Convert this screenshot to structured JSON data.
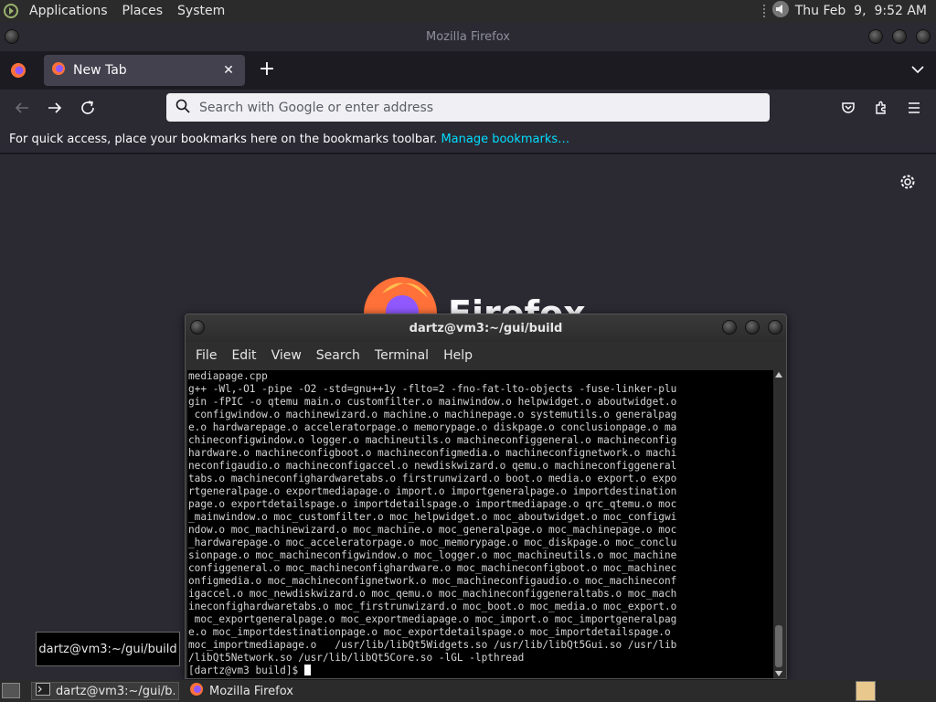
{
  "top_panel": {
    "menus": [
      "Applications",
      "Places",
      "System"
    ],
    "clock": "Thu Feb  9,  9:52 AM"
  },
  "firefox": {
    "window_title": "Mozilla Firefox",
    "tab_label": "New Tab",
    "urlbar_placeholder": "Search with Google or enter address",
    "bookmarks_text": "For quick access, place your bookmarks here on the bookmarks toolbar.",
    "bookmarks_link": "Manage bookmarks…",
    "wordmark": "Firefox"
  },
  "terminal": {
    "title": "dartz@vm3:~/gui/build",
    "menus": [
      "File",
      "Edit",
      "View",
      "Search",
      "Terminal",
      "Help"
    ],
    "lines": [
      "mediapage.cpp",
      "g++ -Wl,-O1 -pipe -O2 -std=gnu++1y -flto=2 -fno-fat-lto-objects -fuse-linker-plu",
      "gin -fPIC -o qtemu main.o customfilter.o mainwindow.o helpwidget.o aboutwidget.o",
      " configwindow.o machinewizard.o machine.o machinepage.o systemutils.o generalpag",
      "e.o hardwarepage.o acceleratorpage.o memorypage.o diskpage.o conclusionpage.o ma",
      "chineconfigwindow.o logger.o machineutils.o machineconfiggeneral.o machineconfig",
      "hardware.o machineconfigboot.o machineconfigmedia.o machineconfignetwork.o machi",
      "neconfigaudio.o machineconfigaccel.o newdiskwizard.o qemu.o machineconfiggeneral",
      "tabs.o machineconfighardwaretabs.o firstrunwizard.o boot.o media.o export.o expo",
      "rtgeneralpage.o exportmediapage.o import.o importgeneralpage.o importdestination",
      "page.o exportdetailspage.o importdetailspage.o importmediapage.o qrc_qtemu.o moc",
      "_mainwindow.o moc_customfilter.o moc_helpwidget.o moc_aboutwidget.o moc_configwi",
      "ndow.o moc_machinewizard.o moc_machine.o moc_generalpage.o moc_machinepage.o moc",
      "_hardwarepage.o moc_acceleratorpage.o moc_memorypage.o moc_diskpage.o moc_conclu",
      "sionpage.o moc_machineconfigwindow.o moc_logger.o moc_machineutils.o moc_machine",
      "configgeneral.o moc_machineconfighardware.o moc_machineconfigboot.o moc_machinec",
      "onfigmedia.o moc_machineconfignetwork.o moc_machineconfigaudio.o moc_machineconf",
      "igaccel.o moc_newdiskwizard.o moc_qemu.o moc_machineconfiggeneraltabs.o moc_mach",
      "ineconfighardwaretabs.o moc_firstrunwizard.o moc_boot.o moc_media.o moc_export.o",
      " moc_exportgeneralpage.o moc_exportmediapage.o moc_import.o moc_importgeneralpag",
      "e.o moc_importdestinationpage.o moc_exportdetailspage.o moc_importdetailspage.o",
      "moc_importmediapage.o   /usr/lib/libQt5Widgets.so /usr/lib/libQt5Gui.so /usr/lib",
      "/libQt5Network.so /usr/lib/libQt5Core.so -lGL -lpthread"
    ],
    "prompt": "[dartz@vm3 build]$ "
  },
  "tooltip": "dartz@vm3:~/gui/build",
  "taskbar": {
    "terminal_task": "dartz@vm3:~/gui/b...",
    "firefox_task": "Mozilla Firefox"
  }
}
